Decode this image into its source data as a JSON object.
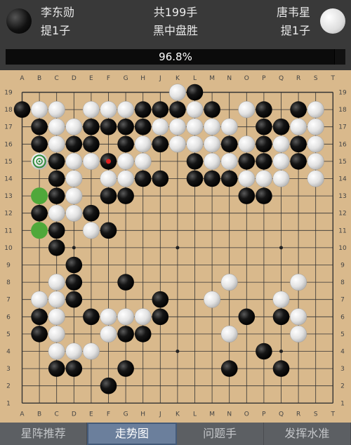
{
  "header": {
    "black_player": "李东勋",
    "black_captures": "提1子",
    "white_player": "唐韦星",
    "white_captures": "提1子",
    "move_count": "共199手",
    "result": "黑中盘胜"
  },
  "win_rate": {
    "label": "96.8%",
    "value": 0.968
  },
  "board": {
    "columns": [
      "A",
      "B",
      "C",
      "D",
      "E",
      "F",
      "G",
      "H",
      "J",
      "K",
      "L",
      "M",
      "N",
      "O",
      "P",
      "Q",
      "R",
      "S",
      "T"
    ],
    "rows": [
      "19",
      "18",
      "17",
      "16",
      "15",
      "14",
      "13",
      "12",
      "11",
      "10",
      "9",
      "8",
      "7",
      "6",
      "5",
      "4",
      "3",
      "2",
      "1"
    ],
    "black": [
      "L19",
      "A18",
      "J18",
      "K18",
      "H18",
      "M18",
      "P18",
      "R18",
      "B17",
      "E17",
      "F17",
      "G17",
      "H17",
      "P17",
      "Q17",
      "B16",
      "D16",
      "E16",
      "G16",
      "J16",
      "N16",
      "P16",
      "R16",
      "C15",
      "F15",
      "L15",
      "O15",
      "P15",
      "R15",
      "C14",
      "H14",
      "J14",
      "L14",
      "M14",
      "N14",
      "C13",
      "F13",
      "G13",
      "O13",
      "P13",
      "B12",
      "E12",
      "C11",
      "F11",
      "C10",
      "D9",
      "D8",
      "G8",
      "D7",
      "J7",
      "B6",
      "E6",
      "J6",
      "O6",
      "Q6",
      "B5",
      "G5",
      "H5",
      "P4",
      "C3",
      "D3",
      "G3",
      "N3",
      "Q3",
      "F2"
    ],
    "white": [
      "K19",
      "B18",
      "C18",
      "E18",
      "F18",
      "G18",
      "L18",
      "O18",
      "S18",
      "C17",
      "D17",
      "J17",
      "K17",
      "L17",
      "M17",
      "N17",
      "R17",
      "S17",
      "C16",
      "H16",
      "K16",
      "L16",
      "M16",
      "O16",
      "Q16",
      "S16",
      "D15",
      "E15",
      "G15",
      "H15",
      "M15",
      "N15",
      "Q15",
      "S15",
      "D14",
      "F14",
      "G14",
      "O14",
      "P14",
      "Q14",
      "S14",
      "D13",
      "C12",
      "D12",
      "E11",
      "C8",
      "N8",
      "R8",
      "B7",
      "C7",
      "M7",
      "Q7",
      "C6",
      "F6",
      "G6",
      "H6",
      "R6",
      "C5",
      "F5",
      "N5",
      "R5",
      "C4",
      "D4",
      "E4"
    ],
    "last_move": "F15",
    "marked": [
      "B15"
    ],
    "highlights": [
      "B13",
      "B11"
    ],
    "star_points": [
      "D16",
      "K16",
      "Q16",
      "D10",
      "K10",
      "Q10",
      "D4",
      "K4",
      "Q4"
    ],
    "colors": {
      "highlight": "#4fa83a",
      "last_move": "#e02020",
      "mark": "#2f8a3a"
    }
  },
  "tabs": [
    {
      "label": "星阵推荐",
      "active": false
    },
    {
      "label": "走势图",
      "active": true
    },
    {
      "label": "问题手",
      "active": false
    },
    {
      "label": "发挥水准",
      "active": false
    }
  ]
}
